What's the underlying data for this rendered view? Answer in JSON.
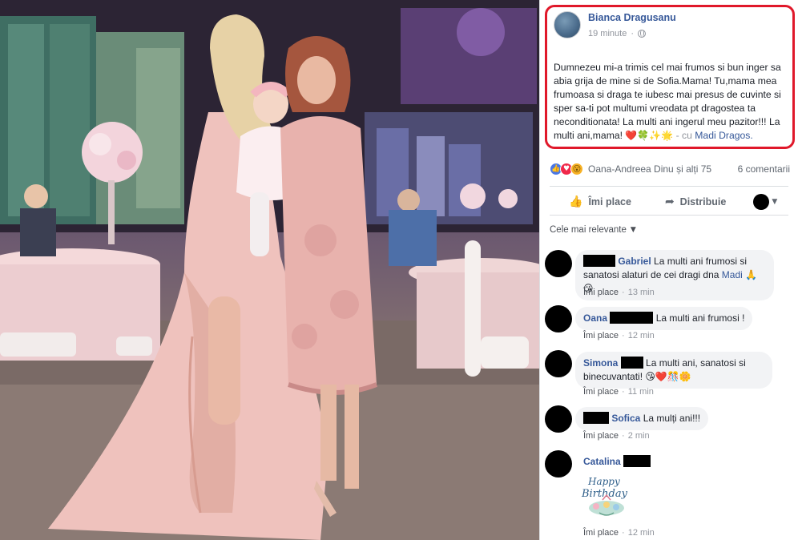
{
  "post": {
    "author": "Bianca Dragusanu",
    "time": "19 minute",
    "privacy_icon": "globe-icon",
    "text": "Dumnezeu mi-a trimis cel mai frumos si bun inger sa abia grija de mine si de Sofia.Mama! Tu,mama mea frumoasa si draga te iubesc mai presus de cuvinte si sper sa-ti pot multumi vreodata pt dragostea ta neconditionata! La multi ani ingerul meu pazitor!!! La multi ani,mama!",
    "emojis": "❤️🍀✨🌟",
    "tag_prefix": "- cu",
    "tagged": "Madi Dragos."
  },
  "reactions": {
    "icons": [
      "like",
      "love",
      "wow"
    ],
    "names": "Oana-Andreea Dinu și alți 75",
    "comments_count": "6 comentarii"
  },
  "actions": {
    "like": "Îmi place",
    "share": "Distribuie"
  },
  "sort": {
    "label": "Cele mai relevante"
  },
  "comments": [
    {
      "name": "Gabriel",
      "text": "La multi ani frumosi si sanatosi alaturi de cei dragi dna",
      "mention": "Madi",
      "emoji": "🙏😘",
      "like": "Îmi place",
      "time": "13 min"
    },
    {
      "name": "Oana",
      "text": "La multi ani frumosi !",
      "like": "Îmi place",
      "time": "12 min"
    },
    {
      "name": "Simona",
      "text": "La multi ani, sanatosi si binecuvantati!",
      "emoji": "😘❤️🎊🌼",
      "like": "Îmi place",
      "time": "11 min"
    },
    {
      "name": "Sofica",
      "text": "La mulți ani!!!",
      "like": "Îmi place",
      "time": "2 min"
    },
    {
      "name": "Catalina",
      "sticker_line1": "Happy",
      "sticker_line2": "Birthday",
      "like": "Îmi place",
      "time": "12 min"
    }
  ],
  "colors": {
    "link": "#365899",
    "highlight_border": "#e0182a",
    "bubble": "#f2f3f5"
  }
}
